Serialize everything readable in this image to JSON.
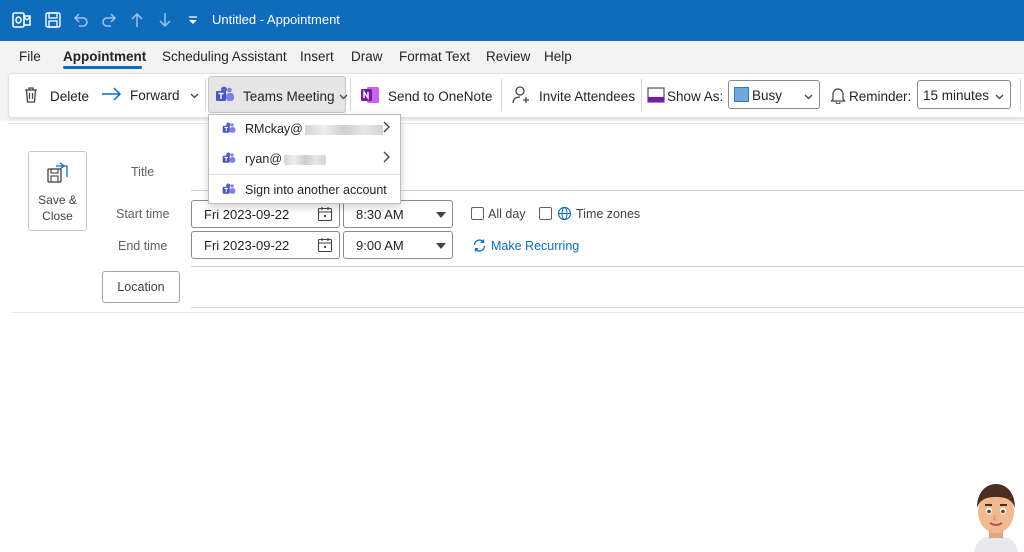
{
  "window": {
    "title": "Untitled  -  Appointment"
  },
  "menu": {
    "tabs": [
      "File",
      "Appointment",
      "Scheduling Assistant",
      "Insert",
      "Draw",
      "Format Text",
      "Review",
      "Help"
    ],
    "active": "Appointment"
  },
  "ribbon": {
    "delete_label": "Delete",
    "forward_label": "Forward",
    "teams_label": "Teams Meeting",
    "onenote_label": "Send to OneNote",
    "invite_label": "Invite Attendees",
    "show_as_label": "Show As:",
    "show_as_value": "Busy",
    "reminder_label": "Reminder:",
    "reminder_value": "15 minutes"
  },
  "dropdown": {
    "items": [
      {
        "label": "RMckay@",
        "has_submenu": true
      },
      {
        "label": "ryan@",
        "has_submenu": true
      },
      {
        "label": "Sign into another account",
        "has_submenu": false
      }
    ]
  },
  "form": {
    "save_close_line1": "Save &",
    "save_close_line2": "Close",
    "title_label": "Title",
    "start_label": "Start time",
    "end_label": "End time",
    "start_date": "Fri 2023-09-22",
    "start_time": "8:30 AM",
    "end_date": "Fri 2023-09-22",
    "end_time": "9:00 AM",
    "all_day_label": "All day",
    "time_zones_label": "Time zones",
    "make_recurring_label": "Make Recurring",
    "location_label": "Location"
  },
  "colors": {
    "accent": "#0f6cbd",
    "teams": "#5b5fc7",
    "onenote": "#7719aa",
    "busy": "#6fa8dc"
  }
}
